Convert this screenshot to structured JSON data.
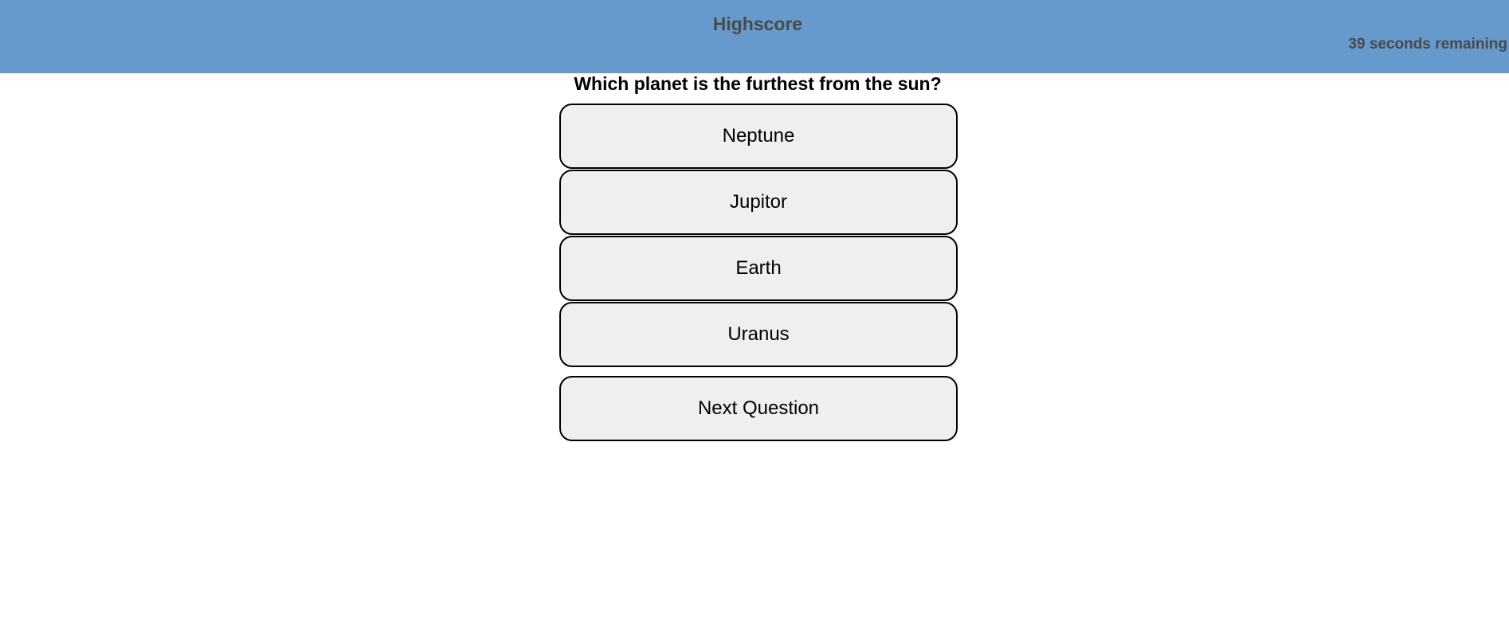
{
  "header": {
    "title": "Highscore",
    "timer": "39 seconds remaining",
    "background_color": "#6699cc"
  },
  "quiz": {
    "question": "Which planet is the furthest from the sun?",
    "answers": [
      "Neptune",
      "Jupitor",
      "Earth",
      "Uranus"
    ],
    "next_label": "Next Question"
  }
}
